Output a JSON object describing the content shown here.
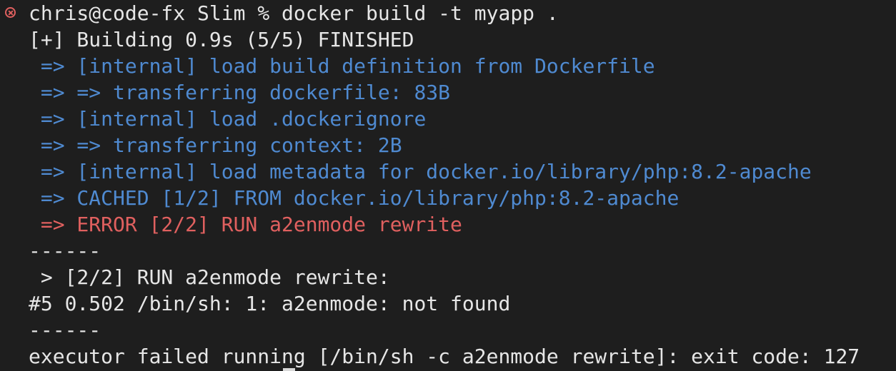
{
  "terminal": {
    "status_icon": "error-circle-x-icon",
    "prompt": {
      "user_host": "chris@code-fx",
      "directory": "Slim",
      "symbol": "%",
      "command": "docker build -t myapp ."
    },
    "lines": [
      {
        "text": "[+] Building 0.9s (5/5) FINISHED",
        "color": "#e6e6e6"
      },
      {
        "text": " => [internal] load build definition from Dockerfile",
        "color": "#4f8ad1"
      },
      {
        "text": " => => transferring dockerfile: 83B",
        "color": "#4f8ad1"
      },
      {
        "text": " => [internal] load .dockerignore",
        "color": "#4f8ad1"
      },
      {
        "text": " => => transferring context: 2B",
        "color": "#4f8ad1"
      },
      {
        "text": " => [internal] load metadata for docker.io/library/php:8.2-apache",
        "color": "#4f8ad1"
      },
      {
        "text": " => CACHED [1/2] FROM docker.io/library/php:8.2-apache",
        "color": "#4f8ad1"
      },
      {
        "text": " => ERROR [2/2] RUN a2enmode rewrite",
        "color": "#e0605f"
      },
      {
        "text": "------",
        "color": "#e6e6e6"
      },
      {
        "text": " > [2/2] RUN a2enmode rewrite:",
        "color": "#e6e6e6"
      },
      {
        "text": "#5 0.502 /bin/sh: 1: a2enmode: not found",
        "color": "#e6e6e6"
      },
      {
        "text": "------",
        "color": "#e6e6e6"
      },
      {
        "text": "executor failed running [/bin/sh -c a2enmode rewrite]: exit code: 127",
        "color": "#e6e6e6"
      }
    ]
  }
}
